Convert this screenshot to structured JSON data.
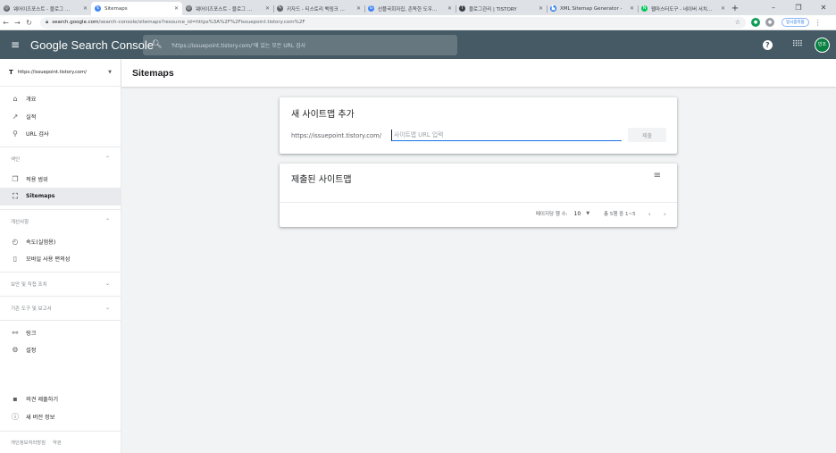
{
  "browser": {
    "tabs": [
      {
        "title": "웨어이즈포스트 - 블로그 ...",
        "fav_color": "#5f6368",
        "fav": "◎",
        "active": false
      },
      {
        "title": "Sitemaps",
        "fav_color": "#4285f4",
        "fav": "↯",
        "active": true
      },
      {
        "title": "웨어이즈포스트 - 블로그 ...",
        "fav_color": "#5f6368",
        "fav": "◎",
        "active": false
      },
      {
        "title": "키자드 - 티스토리 백링크 ...",
        "fav_color": "#5f6368",
        "fav": "✎",
        "active": false
      },
      {
        "title": "선플국회자집, 존독한 도우...",
        "fav_color": "#4285f4",
        "fav": "G",
        "active": false
      },
      {
        "title": "블로그관리 | TISTORY",
        "fav_color": "#3c4043",
        "fav": "T",
        "active": false
      },
      {
        "title": "XML Sitemap Generator -",
        "fav_color": "#1a73e8",
        "fav": "▙",
        "active": false
      },
      {
        "title": "웹마스터도구 - 네이버 서치...",
        "fav_color": "#03c75a",
        "fav": "N",
        "active": false
      }
    ],
    "new_tab": "+",
    "window_controls": [
      "–",
      "❐",
      "✕"
    ],
    "url_host": "search.google.com",
    "url_path": "/search-console/sitemaps?resource_id=https%3A%2F%2Fissuepoint.tistory.com%2F",
    "profile_pill": "일시중지됨"
  },
  "app": {
    "brand": "Google Search Console",
    "search_placeholder": "'https://issuepoint.tistory.com/'에 있는 모든 URL 검사",
    "help": "?",
    "avatar": "빈조"
  },
  "sidebar": {
    "property": "https://issuepoint.tistory.com/",
    "top_items": [
      {
        "label": "개요",
        "icon": "home-icon"
      },
      {
        "label": "실적",
        "icon": "trending-icon"
      },
      {
        "label": "URL 검사",
        "icon": "search-icon"
      }
    ],
    "section_index": "색인",
    "index_items": [
      {
        "label": "적용 범위",
        "icon": "copy-icon"
      },
      {
        "label": "Sitemaps",
        "icon": "sitemap-icon",
        "active": true
      }
    ],
    "section_enhancements": "개선사항",
    "enhancement_items": [
      {
        "label": "속도(실험용)",
        "icon": "speed-icon"
      },
      {
        "label": "모바일 사용 편의성",
        "icon": "phone-icon"
      }
    ],
    "section_security": "보안 및 직접 조치",
    "section_legacy": "기존 도구 및 보고서",
    "other_items": [
      {
        "label": "링크",
        "icon": "links-icon"
      },
      {
        "label": "설정",
        "icon": "settings-icon"
      }
    ],
    "bottom_items": [
      {
        "label": "의견 제출하기",
        "icon": "feedback-icon"
      },
      {
        "label": "새 버전 정보",
        "icon": "info-icon"
      }
    ],
    "footer": {
      "privacy": "개인정보처리방침",
      "terms": "약관"
    }
  },
  "main": {
    "page_title": "Sitemaps",
    "add_card": {
      "title": "새 사이트맵 추가",
      "prefix": "https://issuepoint.tistory.com/",
      "placeholder": "사이트맵 URL 입력",
      "submit": "제출"
    },
    "submitted_card": {
      "title": "제출된 사이트맵",
      "rows_label": "페이지당 행 수:",
      "rows_value": "10",
      "range": "총 5행 중 1~5",
      "prev": "‹",
      "next": "›"
    }
  }
}
